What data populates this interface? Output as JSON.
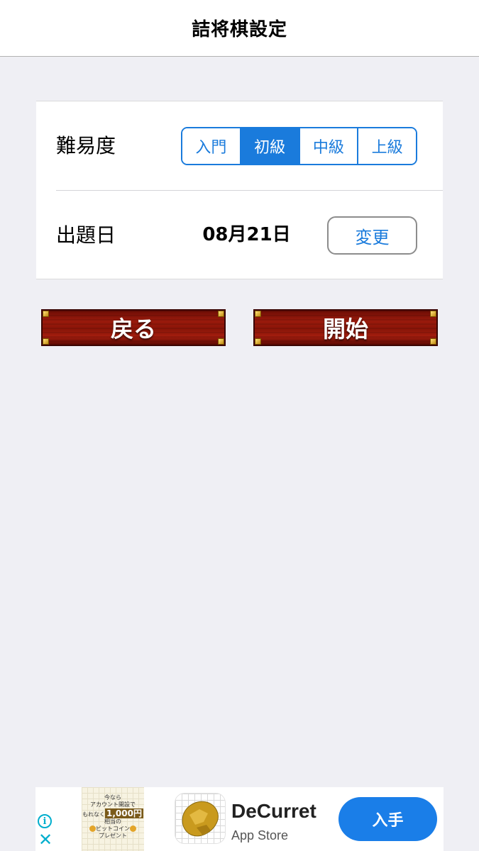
{
  "navbar": {
    "title": "詰将棋設定"
  },
  "settings": {
    "difficulty": {
      "label": "難易度",
      "options": [
        "入門",
        "初級",
        "中級",
        "上級"
      ],
      "selected_index": 1
    },
    "date": {
      "label": "出題日",
      "value": "08月21日",
      "change_label": "変更"
    }
  },
  "actions": {
    "back_label": "戻る",
    "start_label": "開始"
  },
  "ad": {
    "banner_lines": [
      "今なら",
      "アカウント開設で",
      "もれなく",
      "1,000円",
      "相当の",
      "ビットコイン",
      "プレゼント"
    ],
    "app_name": "DeCurret",
    "store": "App Store",
    "cta": "入手",
    "info_icon": "info-icon",
    "close_icon": "close-icon"
  },
  "colors": {
    "accent": "#1a7bdc",
    "background": "#efeff4",
    "wood": "#8a1508",
    "ad_icon": "#00aecd"
  }
}
